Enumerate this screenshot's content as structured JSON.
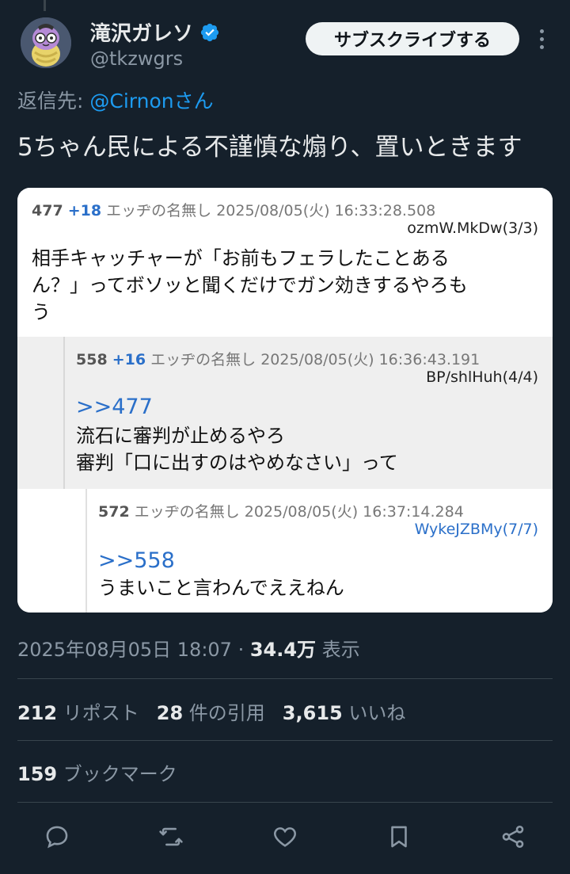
{
  "author": {
    "display_name": "滝沢ガレソ",
    "handle": "@tkzwgrs",
    "verified": true
  },
  "subscribe_label": "サブスクライブする",
  "reply_to": {
    "prefix": "返信先: ",
    "mention": "@Cirnon",
    "suffix": "さん"
  },
  "tweet_text": "5ちゃん民による不謹慎な煽り、置いときます",
  "screenshot": {
    "posts": [
      {
        "number": "477",
        "replies": "+18",
        "name": "エッヂの名無し",
        "datetime": "2025/08/05(火) 16:33:28.508",
        "id": "ozmW.MkDw(3/3)",
        "anchor": "",
        "lines": [
          "相手キャッチャーが「お前もフェラしたことある",
          "ん？」ってボソッと聞くだけでガン効きするやろも",
          "う"
        ]
      },
      {
        "number": "558",
        "replies": "+16",
        "name": "エッヂの名無し",
        "datetime": "2025/08/05(火) 16:36:43.191",
        "id": "BP/shlHuh(4/4)",
        "anchor": ">>477",
        "lines": [
          "流石に審判が止めるやろ",
          "審判「口に出すのはやめなさい」って"
        ]
      },
      {
        "number": "572",
        "replies": "",
        "name": "エッヂの名無し",
        "datetime": "2025/08/05(火) 16:37:14.284",
        "id": "WykeJZBMy(7/7)",
        "anchor": ">>558",
        "lines": [
          "うまいこと言わんでええねん"
        ]
      }
    ]
  },
  "timestamp": "2025年08月05日 18:07 · ",
  "views_count": "34.4万",
  "views_label": " 表示",
  "stats": {
    "reposts_count": "212",
    "reposts_label": " リポスト",
    "quotes_count": "28",
    "quotes_label": " 件の引用",
    "likes_count": "3,615",
    "likes_label": " いいね",
    "bookmarks_count": "159",
    "bookmarks_label": " ブックマーク"
  },
  "icons": [
    "reply-icon",
    "retweet-icon",
    "like-icon",
    "bookmark-icon",
    "share-icon"
  ],
  "colors": {
    "background": "#15202b",
    "accent": "#1d9bf0",
    "text": "#e7e9ea",
    "muted": "#8b98a5"
  }
}
